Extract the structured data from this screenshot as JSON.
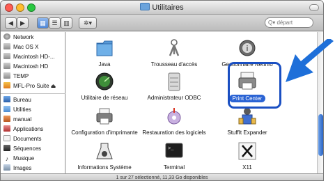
{
  "window": {
    "title": "Utilitaires"
  },
  "toolbar": {
    "back_label": "◀",
    "forward_label": "▶",
    "view_icons_label": "▦",
    "view_list_label": "☰",
    "view_columns_label": "▥",
    "action_label": "✲▾",
    "search_placeholder": "Q▾ départ"
  },
  "sidebar": {
    "devices": [
      {
        "label": "Network",
        "icon": "globe-icon"
      },
      {
        "label": "Mac OS X",
        "icon": "hard-disk-icon"
      },
      {
        "label": "Macintosh HD-...",
        "icon": "hard-disk-icon"
      },
      {
        "label": "Macintosh HD",
        "icon": "hard-disk-icon"
      },
      {
        "label": "TEMP",
        "icon": "hard-disk-icon"
      },
      {
        "label": "MFL-Pro Suite ⏏",
        "icon": "cd-icon"
      }
    ],
    "places": [
      {
        "label": "Bureau",
        "icon": "desktop-icon"
      },
      {
        "label": "Utilities",
        "icon": "folder-icon"
      },
      {
        "label": "manual",
        "icon": "home-icon"
      },
      {
        "label": "Applications",
        "icon": "applications-icon"
      },
      {
        "label": "Documents",
        "icon": "documents-icon"
      },
      {
        "label": "Séquences",
        "icon": "movies-icon"
      },
      {
        "label": "Musique",
        "icon": "music-icon"
      },
      {
        "label": "Images",
        "icon": "pictures-icon"
      }
    ]
  },
  "items": [
    {
      "label": "Java",
      "icon": "java-folder-icon"
    },
    {
      "label": "Trousseau d'accès",
      "icon": "keychain-icon"
    },
    {
      "label": "Gestionnaire NetInfo",
      "icon": "netinfo-icon"
    },
    {
      "label": "Utilitaire de réseau",
      "icon": "network-utility-icon"
    },
    {
      "label": "Administrateur ODBC",
      "icon": "odbc-icon"
    },
    {
      "label": "Print Center",
      "icon": "printer-icon",
      "selected": true
    },
    {
      "label": "Configuration d'imprimante",
      "icon": "printer-setup-icon"
    },
    {
      "label": "Restauration des logiciels",
      "icon": "software-restore-icon"
    },
    {
      "label": "StuffIt Expander",
      "icon": "stuffit-icon"
    },
    {
      "label": "Informations Système",
      "icon": "system-profiler-icon"
    },
    {
      "label": "Terminal",
      "icon": "terminal-icon"
    },
    {
      "label": "X11",
      "icon": "x11-icon"
    }
  ],
  "status": "1 sur 27 sélectionné, 11,33 Go disponibles",
  "colors": {
    "accent": "#2a63d4",
    "highlight": "#1a4fc2",
    "arrow": "#1e6fd9"
  }
}
